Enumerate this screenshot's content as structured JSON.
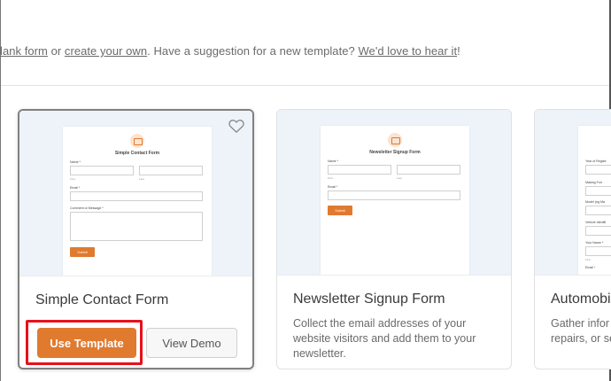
{
  "intro": {
    "link_blank": "lank form",
    "text_or": " or ",
    "link_create": "create your own",
    "text_mid": ". Have a suggestion for a new template? ",
    "link_suggest": "We'd love to hear it",
    "text_end": "!"
  },
  "colors": {
    "accent": "#e07a2f",
    "highlight": "#e8101a",
    "preview_bg": "#eef3fa"
  },
  "cards": [
    {
      "title": "Simple Contact Form",
      "selected": true,
      "favorite_icon": "heart-outline-icon",
      "use_label": "Use Template",
      "demo_label": "View Demo",
      "preview": {
        "form_title": "Simple Contact Form",
        "name_label": "Name *",
        "first_label": "First",
        "last_label": "Last",
        "email_label": "Email *",
        "comment_label": "Comment or Message *",
        "submit_label": "Submit"
      }
    },
    {
      "title": "Newsletter Signup Form",
      "description": "Collect the email addresses of your website visitors and add them to your newsletter.",
      "preview": {
        "form_title": "Newsletter Signup Form",
        "name_label": "Name *",
        "first_label": "First",
        "last_label": "Last",
        "email_label": "Email *",
        "submit_label": "Submit"
      }
    },
    {
      "title": "Automobi",
      "description": "Gather infor repairs, or se",
      "preview": {
        "label_1": "Year of Registr",
        "label_2": "Making Fori",
        "label_3": "Model (eg Ma",
        "label_4": "Vehicle Identifi",
        "label_5": "Your Name *",
        "label_6": "First",
        "label_7": "Email *"
      }
    }
  ]
}
